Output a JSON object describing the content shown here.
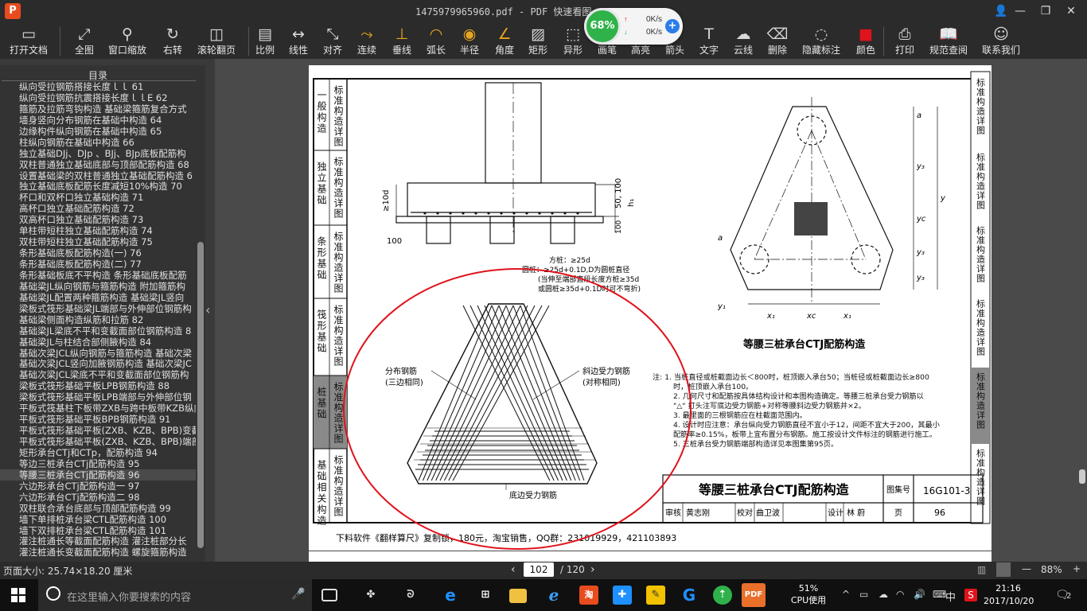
{
  "titlebar": {
    "logo_glyph": "P",
    "title": "1475979965960.pdf - PDF 快速看图 v1.9",
    "controls": [
      "👤",
      "—",
      "❐",
      "✕"
    ]
  },
  "speed_widget": {
    "percent": "68%",
    "up_arrow": "↑",
    "down_arrow": "↓",
    "upload": "0K/s",
    "download": "0K/s",
    "plus": "+"
  },
  "toolbar": {
    "buttons": [
      {
        "label": "打开文档",
        "icon": "▭"
      },
      {
        "label": "全图",
        "icon": "⤢"
      },
      {
        "label": "窗口缩放",
        "icon": "⚲"
      },
      {
        "label": "右转",
        "icon": "↻"
      },
      {
        "label": "滚轮翻页",
        "icon": "◫"
      },
      {
        "label": "比例",
        "icon": "▤"
      },
      {
        "label": "线性",
        "icon": "↔"
      },
      {
        "label": "对齐",
        "icon": "⤡"
      },
      {
        "label": "连续",
        "icon": "⤳"
      },
      {
        "label": "垂线",
        "icon": "⊥"
      },
      {
        "label": "弧长",
        "icon": "◠"
      },
      {
        "label": "半径",
        "icon": "◉"
      },
      {
        "label": "角度",
        "icon": "∠"
      },
      {
        "label": "矩形",
        "icon": "▨"
      },
      {
        "label": "异形",
        "icon": "⬚"
      },
      {
        "label": "画笔",
        "icon": "✎"
      },
      {
        "label": "高亮",
        "icon": "▮"
      },
      {
        "label": "箭头",
        "icon": "➚"
      },
      {
        "label": "文字",
        "icon": "T"
      },
      {
        "label": "云线",
        "icon": "☁"
      },
      {
        "label": "删除",
        "icon": "⌫"
      },
      {
        "label": "隐藏标注",
        "icon": "◌"
      },
      {
        "label": "颜色",
        "icon": "■"
      },
      {
        "label": "打印",
        "icon": "⎙"
      },
      {
        "label": "规范查阅",
        "icon": "📖"
      },
      {
        "label": "联系我们",
        "icon": "☺"
      }
    ]
  },
  "sidebar": {
    "title": "目录",
    "items": [
      "纵向受拉钢筋搭接长度ｌｌ 61",
      "纵向受拉钢筋抗震搭接长度ｌｌE 62",
      "箍筋及拉筋弯钩构造 基础梁箍筋复合方式",
      "墙身竖向分布钢筋在基础中构造 64",
      "边缘构件纵向钢筋在基础中构造 65",
      "柱纵向钢筋在基础中构造 66",
      "独立基础DJj、DJp 、BJj、BJp底板配筋构",
      "双柱普通独立基础底部与顶部配筋构造 68",
      "设置基础梁的双柱普通独立基础配筋构造 6",
      "独立基础底板配筋长度减短10%构造 70",
      "杯口和双杯口独立基础构造 71",
      "高杯口独立基础配筋构造 72",
      "双高杯口独立基础配筋构造 73",
      "单柱带短柱独立基础配筋构造 74",
      "双柱带短柱独立基础配筋构造 75",
      "条形基础底板配筋构造(一) 76",
      "条形基础底板配筋构造(二) 77",
      "条形基础板底不平构造 条形基础底板配筋",
      "基础梁JL纵向钢筋与箍筋构造 附加箍筋构",
      "基础梁JL配置两种箍筋构造 基础梁JL竖向",
      "梁板式筏形基础梁JL端部与外伸部位钢筋构",
      "基础梁侧面构造纵筋和拉筋 82",
      "基础梁JL梁底不平和变截面部位钢筋构造 8",
      "基础梁JL与柱结合部侧腋构造 84",
      "基础次梁JCL纵向钢筋与箍筋构造 基础次梁",
      "基础次梁JCL竖向加腋钢筋构造 基础次梁JC",
      "基础次梁JCL梁底不平和变截面部位钢筋构",
      "梁板式筏形基础平板LPB钢筋构造 88",
      "梁板式筏形基础平板LPB端部与外伸部位钢",
      "平板式筏基柱下板带ZXB与跨中板带KZB纵向",
      "平板式筏形基础平板BPB钢筋构造 91",
      "平板式筏形基础平板(ZXB、KZB、BPB)变截",
      "平板式筏形基础平板(ZXB、KZB、BPB)端部",
      "矩形承台CTj和CTp，配筋构造 94",
      "等边三桩承台CTj配筋构造 95",
      "等腰三桩承台CTj配筋构造 96",
      "六边形承台CTj配筋构造一 97",
      "六边形承台CTj配筋构造二 98",
      "双柱联合承台底部与顶部配筋构造 99",
      "墙下单排桩承台梁CTL配筋构造 100",
      "墙下双排桩承台梁CTL配筋构造 101",
      "灌注桩通长等截面配筋构造 灌注桩部分长",
      "灌注桩通长变截面配筋构造 螺旋箍筋构造"
    ],
    "selected_index": 35,
    "collapse_glyph": "‹"
  },
  "statusbar": {
    "page_size": "页面大小: 25.74×18.20 厘米",
    "prev": "‹",
    "next": "›",
    "current_page": "102",
    "total_pages": "/ 120",
    "zoom_minus": "—",
    "zoom_plus": "+",
    "zoom": "88%"
  },
  "document": {
    "side_tabs": [
      "标准构造详图",
      "标准构造详图",
      "标准构造详图",
      "标准构造详图",
      "标准构造详图",
      "标准构造详图"
    ],
    "side_cats": [
      "一般构造",
      "独立基础",
      "条形基础",
      "筏形基础",
      "桩基础",
      "基础相关构造"
    ],
    "right_tabs": [
      "标准构造详图",
      "标准构造详图",
      "标准构造详图",
      "标准构造详图",
      "标准构造详图",
      "标准构造详图"
    ],
    "section_labels": {
      "d10": "≥10d",
      "d100a": "100",
      "d50": "50, 100",
      "h1": "h₁",
      "d100b": "100",
      "pile_note1": "方桩：≥25d",
      "pile_note2": "圆桩：≥25d+0.1D,D为圆桩直径",
      "pile_note3": "(当伸至端部直段长度方桩≥35d",
      "pile_note4": "或圆桩≥35d+0.1D时可不弯折)"
    },
    "plan_labels": {
      "a_top": "a",
      "y3a": "y₃",
      "y": "y",
      "yc": "yc",
      "y3b": "y₃",
      "a_left": "a",
      "y1": "y₁",
      "y3c": "y₃",
      "x1a": "x₁",
      "xc": "xc",
      "x1b": "x₁"
    },
    "plan_title": "等腰三桩承台CTJ配筋构造",
    "rebar_labels": {
      "dist_label1": "分布钢筋",
      "dist_label2": "(三边相同)",
      "diag_label1": "斜边受力钢筋",
      "diag_label2": "(对称相同)",
      "bottom_label": "底边受力钢筋"
    },
    "notes": [
      "注: 1. 当桩直径或桩截面边长＜800时，桩顶嵌入承台50；当桩径或桩截面边长≥800",
      "时，桩顶嵌入承台100。",
      "2. 几何尺寸和配筋按具体结构设计和本图构造确定。等腰三桩承台受力钢筋以",
      "\"△\" 打头注写底边受力钢筋+对称等腰斜边受力钢筋并×2。",
      "3. 最里面的三根钢筋应在柱截面范围内。",
      "4. 设计时应注意：承台纵向受力钢筋直径不宜小于12，间距不宜大于200，其最小",
      "配筋率≥0.15%，板带上宜布置分布钢筋。施工按设计文件标注的钢筋进行施工。",
      "5. 三桩承台受力钢筋端部构造详见本图集第95页。"
    ],
    "titleblock": {
      "title": "等腰三桩承台CTJ配筋构造",
      "set_label": "图集号",
      "set_no": "16G101-3",
      "review": "审核",
      "reviewer": "黄志刚",
      "check": "校对",
      "checker": "曲卫波",
      "design": "设计",
      "designer": "林 蔚",
      "page_label": "页",
      "page_no": "96"
    },
    "footer": "下料软件《翻样算尺》复制锁，180元，淘宝销售，QQ群：231019929，421103893"
  },
  "taskbar": {
    "search_placeholder": "在这里输入你要搜索的内容",
    "cpu_percent": "51%",
    "cpu_label": "CPU使用",
    "ime": "中",
    "time": "21:16",
    "date": "2017/10/20",
    "notif_count": "2"
  },
  "colors": {
    "accent_red": "#e0121b",
    "speed_green": "#2fb24a"
  }
}
